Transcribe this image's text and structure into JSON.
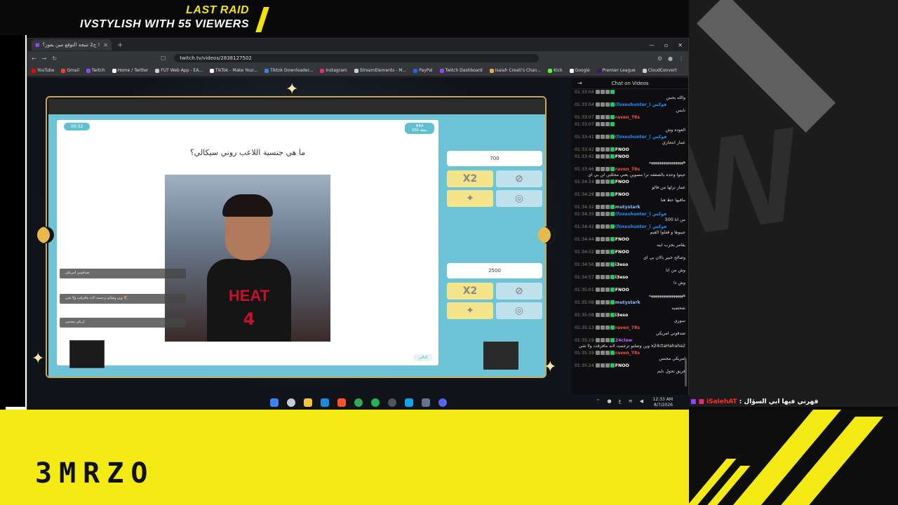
{
  "overlay": {
    "raid_line1": "LAST RAID",
    "raid_line2": "IVSTYLISH WITH 55 VIEWERS",
    "brand": "3MRZO",
    "bottom_chat_name": "iSalehAT",
    "bottom_chat_text": ": قهرني فيها ابي السؤال"
  },
  "browser": {
    "tab_title": "ج2 نتيجة التوقع مين يفوز؟ !!",
    "url": "twitch.tv/videos/2838127502",
    "bookmarks": [
      {
        "label": "YouTube",
        "color": "#ff0000"
      },
      {
        "label": "Gmail",
        "color": "#ea4335"
      },
      {
        "label": "Twitch",
        "color": "#9146ff"
      },
      {
        "label": "Home / Twitter",
        "color": "#ffffff"
      },
      {
        "label": "FUT Web App - EA...",
        "color": "#cccccc"
      },
      {
        "label": "TikTok - Make Your...",
        "color": "#ffffff"
      },
      {
        "label": "Tiktok Downloader...",
        "color": "#3b82f6"
      },
      {
        "label": "Instagram",
        "color": "#e1306c"
      },
      {
        "label": "StreamElements - M...",
        "color": "#cccccc"
      },
      {
        "label": "PayPal",
        "color": "#2563eb"
      },
      {
        "label": "Twitch Dashboard",
        "color": "#9146ff"
      },
      {
        "label": "Isaiah Creati's Chan...",
        "color": "#e5b04a"
      },
      {
        "label": "Kick",
        "color": "#53fc18"
      },
      {
        "label": "Google",
        "color": "#ffffff"
      },
      {
        "label": "Premier League",
        "color": "#3d195b"
      },
      {
        "label": "CloudConvert",
        "color": "#cccccc"
      }
    ]
  },
  "game": {
    "timer": "00:32",
    "badge": "NBA\n500 نقطة",
    "question": "ما هي جنسية اللاعب روني سيكالي؟",
    "jersey_text": "HEAT",
    "jersey_number": "4",
    "score1": "700",
    "score2": "2500",
    "next_button": "التالي",
    "chat_overlay": [
      "صدقوني امريكي",
      "وين وصلتو ترجمت لانه مافرقت ولا شي 🐒",
      "اريكي مجنس"
    ]
  },
  "chat": {
    "header": "Chat on Videos",
    "messages": [
      {
        "ts": "01:33:04",
        "user": "",
        "color": "#ddd",
        "text": "والله يحس"
      },
      {
        "ts": "01:33:04",
        "user": "(foxeshunter_) فوكس",
        "color": "#1e90ff",
        "text": "نايس"
      },
      {
        "ts": "01:33:07",
        "user": "raven_78s",
        "color": "#ff4d4d",
        "text": ""
      },
      {
        "ts": "01:33:07",
        "user": "",
        "color": "#ddd",
        "text": "العوده وش"
      },
      {
        "ts": "01:33:41",
        "user": "(foxeshunter_) فوكس",
        "color": "#1e90ff",
        "text": "عمار انتحاري"
      },
      {
        "ts": "01:33:42",
        "user": "FNOO",
        "color": "#ffffff",
        "text": ""
      },
      {
        "ts": "01:33:42",
        "user": "FNOO",
        "color": "#ffffff",
        "text": "هههههههههههههههههه"
      },
      {
        "ts": "01:33:46",
        "user": "raven_78s",
        "color": "#ff4d4d",
        "text": "جيتوا وحده بالصفقه ترا مسوين يعني محللين لن بي اي"
      },
      {
        "ts": "01:34:24",
        "user": "FNOO",
        "color": "#ffffff",
        "text": "عمار ترلها من فالو"
      },
      {
        "ts": "01:34:28",
        "user": "FNOO",
        "color": "#ffffff",
        "text": "مافيها حظ هنا"
      },
      {
        "ts": "01:34:32",
        "user": "mutystark",
        "color": "#8fb8ff",
        "text": ""
      },
      {
        "ts": "01:34:35",
        "user": "(foxeshunter_) فوكس",
        "color": "#1e90ff",
        "text": "من انا 500"
      },
      {
        "ts": "01:34:42",
        "user": "(foxeshunter_) فوكس",
        "color": "#1e90ff",
        "text": "جيبوها و قفلوا القيم"
      },
      {
        "ts": "01:34:44",
        "user": "FNOO",
        "color": "#ffffff",
        "text": "يقامر يجرب ابيه"
      },
      {
        "ts": "01:34:52",
        "user": "FNOO",
        "color": "#ffffff",
        "text": "وصالح خبير بالان بي اي"
      },
      {
        "ts": "01:34:56",
        "user": "i3eso",
        "color": "#ffffff",
        "text": "وش من انا"
      },
      {
        "ts": "01:34:57",
        "user": "i3eso",
        "color": "#ffffff",
        "text": "وش ذا"
      },
      {
        "ts": "01:35:01",
        "user": "FNOO",
        "color": "#ffffff",
        "text": "هههههههههههههههههه"
      },
      {
        "ts": "01:35:08",
        "user": "mutystark",
        "color": "#8fb8ff",
        "text": "شخصيه"
      },
      {
        "ts": "01:35:08",
        "user": "i3eso",
        "color": "#ffffff",
        "text": "سوري"
      },
      {
        "ts": "01:35:13",
        "user": "raven_78s",
        "color": "#ff4d4d",
        "text": "صدقوني امريكي"
      },
      {
        "ts": "01:35:19",
        "user": "24claw",
        "color": "#b36bff",
        "text": "وين وصلتو ترجمت لانه مافرقت ولا شي x24ctaHahaha2"
      },
      {
        "ts": "01:35:19",
        "user": "raven_78s",
        "color": "#ff4d4d",
        "text": "امريكي مجنس"
      },
      {
        "ts": "01:35:24",
        "user": "FNOO",
        "color": "#ffffff",
        "text": "فريق تحول نايم"
      }
    ]
  },
  "taskbar": {
    "time": "12:33 AM",
    "date": "8/7/2026"
  }
}
